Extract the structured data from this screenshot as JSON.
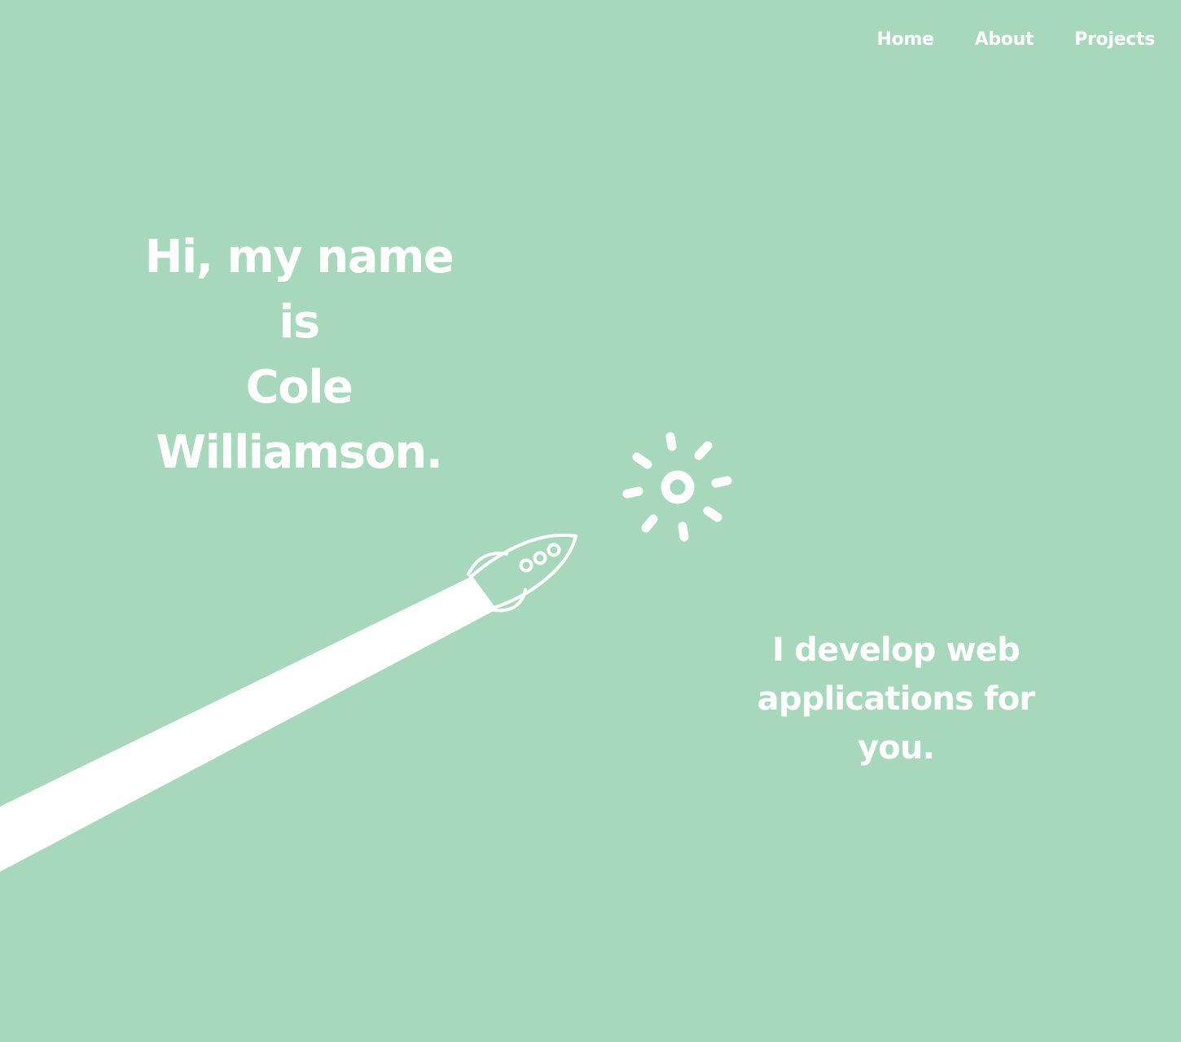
{
  "nav": {
    "items": [
      {
        "label": "Home"
      },
      {
        "label": "About"
      },
      {
        "label": "Projects"
      }
    ]
  },
  "hero": {
    "title_lines": [
      "Hi, my name",
      "is",
      "Cole",
      "Williamson."
    ]
  },
  "tagline": {
    "lines": [
      "I develop web",
      "applications for",
      "you."
    ]
  },
  "icons": [
    "rocket-icon",
    "sun-icon"
  ],
  "colors": {
    "background": "#a8d8bc",
    "foreground": "#ffffff"
  }
}
